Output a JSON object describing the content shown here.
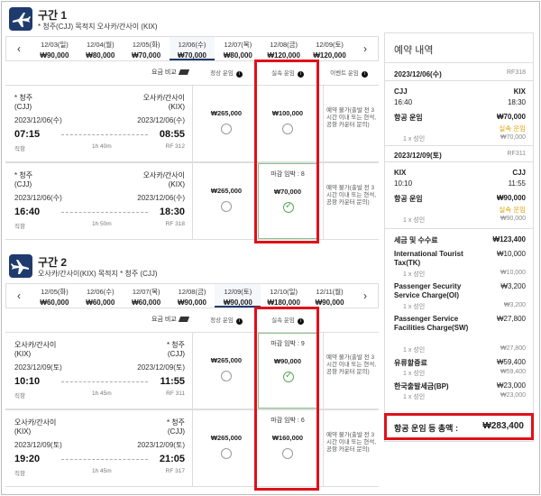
{
  "section1": {
    "title": "구간 1",
    "subtitle": "* 청주(CJJ) 목적지 오사카/간사이 (KIX)",
    "dates": [
      {
        "day": "12/03(일)",
        "price": "₩90,000"
      },
      {
        "day": "12/04(월)",
        "price": "₩80,000"
      },
      {
        "day": "12/05(화)",
        "price": "₩70,000"
      },
      {
        "day": "12/06(수)",
        "price": "₩70,000"
      },
      {
        "day": "12/07(목)",
        "price": "₩80,000"
      },
      {
        "day": "12/08(금)",
        "price": "₩120,000"
      },
      {
        "day": "12/09(토)",
        "price": "₩120,000"
      }
    ],
    "fare_compare": "요금 비교",
    "fare_cols": [
      "정상 운임",
      "실속 운임",
      "이벤트 운임"
    ],
    "flights": [
      {
        "from_city": "* 청주",
        "from_code": "(CJJ)",
        "to_city": "오사카/간사이",
        "to_code": "(KIX)",
        "dep_date": "2023/12/06(수)",
        "arr_date": "2023/12/06(수)",
        "dep_time": "07:15",
        "arr_time": "08:55",
        "duration": "1h 40m",
        "type": "직항",
        "flight_no": "RF 312",
        "normal": "₩265,000",
        "saver": "₩100,000",
        "deadline": "",
        "note": "예약 불가(출발 전 3시간 이내 또는 현석, 공항 카운터 문의)"
      },
      {
        "from_city": "* 청주",
        "from_code": "(CJJ)",
        "to_city": "오사카/간사이",
        "to_code": "(KIX)",
        "dep_date": "2023/12/06(수)",
        "arr_date": "2023/12/06(수)",
        "dep_time": "16:40",
        "arr_time": "18:30",
        "duration": "1h 50m",
        "type": "직항",
        "flight_no": "RF 318",
        "normal": "₩265,000",
        "saver": "₩70,000",
        "deadline": "마감 임박 : 8",
        "note": "예약 불가(출발 전 3시간 이내 또는 현석, 공항 카운터 문의)"
      }
    ]
  },
  "section2": {
    "title": "구간 2",
    "subtitle": "오사카/간사이(KIX) 목적지 * 청주 (CJJ)",
    "dates": [
      {
        "day": "12/05(화)",
        "price": "₩60,000"
      },
      {
        "day": "12/06(수)",
        "price": "₩60,000"
      },
      {
        "day": "12/07(목)",
        "price": "₩60,000"
      },
      {
        "day": "12/08(금)",
        "price": "₩90,000"
      },
      {
        "day": "12/09(토)",
        "price": "₩90,000"
      },
      {
        "day": "12/10(일)",
        "price": "₩180,000"
      },
      {
        "day": "12/11(월)",
        "price": "₩90,000"
      }
    ],
    "fare_compare": "요금 비교",
    "fare_cols": [
      "정상 운임",
      "실속 운임"
    ],
    "flights": [
      {
        "from_city": "오사카/간사이",
        "from_code": "(KIX)",
        "to_city": "* 청주",
        "to_code": "(CJJ)",
        "dep_date": "2023/12/09(토)",
        "arr_date": "2023/12/09(토)",
        "dep_time": "10:10",
        "arr_time": "11:55",
        "duration": "1h 45m",
        "type": "직항",
        "flight_no": "RF 311",
        "normal": "₩265,000",
        "saver": "₩90,000",
        "deadline": "마감 임박 : 9",
        "note": "예약 불가(출발 전 3시간 이내 또는 현석, 공항 카운터 문의)"
      },
      {
        "from_city": "오사카/간사이",
        "from_code": "(KIX)",
        "to_city": "* 청주",
        "to_code": "(CJJ)",
        "dep_date": "2023/12/09(토)",
        "arr_date": "2023/12/09(토)",
        "dep_time": "19:20",
        "arr_time": "21:05",
        "duration": "1h 45m",
        "type": "직항",
        "flight_no": "RF 317",
        "normal": "₩265,000",
        "saver": "₩160,000",
        "deadline": "마감 임박 : 6",
        "note": "예약 불가(출발 전 3시간 이내 또는 현석, 공항 카운터 문의)"
      }
    ]
  },
  "summary": {
    "title": "예약 내역",
    "leg1": {
      "date": "2023/12/06(수)",
      "flight": "RF318",
      "from": "CJJ",
      "to": "KIX",
      "dep": "16:40",
      "arr": "18:30",
      "fare_label": "항공 운임",
      "fare": "₩70,000",
      "class": "실속 운임",
      "pax": "1 x 성인",
      "pax_fare": "₩70,000"
    },
    "leg2": {
      "date": "2023/12/09(토)",
      "flight": "RF311",
      "from": "KIX",
      "to": "CJJ",
      "dep": "10:10",
      "arr": "11:55",
      "fare_label": "항공 운임",
      "fare": "₩90,000",
      "class": "실속 운임",
      "pax": "1 x 성인",
      "pax_fare": "₩90,000"
    },
    "tax_label": "세금 및 수수료",
    "tax_total": "₩123,400",
    "taxes": [
      {
        "name": "International Tourist Tax(TK)",
        "amount": "₩10,000",
        "pax": "1 x 성인",
        "pax_amount": "₩10,000"
      },
      {
        "name": "Passenger Security Service Charge(OI)",
        "amount": "₩3,200",
        "pax": "1 x 성인",
        "pax_amount": "₩3,200"
      },
      {
        "name": "Passenger Service Facilities Charge(SW)",
        "amount": "₩27,800",
        "pax": "1 x 성인",
        "pax_amount": "₩27,800"
      },
      {
        "name": "유류할증료",
        "amount": "₩59,400",
        "pax": "1 x 성인",
        "pax_amount": "₩59,400"
      },
      {
        "name": "한국출발세금(BP)",
        "amount": "₩23,000",
        "pax": "1 x 성인",
        "pax_amount": "₩23,000"
      }
    ],
    "total_label": "항공 운임 등 총액 :",
    "total": "₩283,400"
  }
}
